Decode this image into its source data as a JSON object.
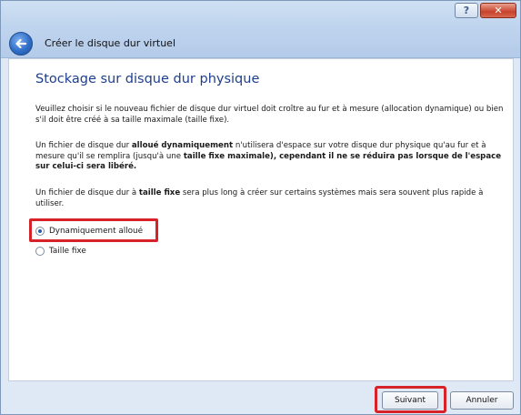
{
  "window": {
    "title": "Créer le disque dur virtuel",
    "help_label": "?",
    "close_label": "✕"
  },
  "page": {
    "heading": "Stockage sur disque dur physique"
  },
  "paragraphs": {
    "p1": "Veuillez choisir si le nouveau fichier de disque dur virtuel doit croître au fur et à mesure (allocation dynamique) ou bien s'il doit être créé à sa taille maximale (taille fixe).",
    "p2_a": "Un fichier de disque dur ",
    "p2_b": "alloué dynamiquement",
    "p2_c": " n'utilisera d'espace sur votre disque dur physique qu'au fur et à mesure qu'il se remplira (jusqu'à une ",
    "p2_d": "taille fixe maximale), cependant il ne se réduira pas lorsque de l'espace sur celui-ci sera libéré.",
    "p3_a": "Un fichier de disque dur à ",
    "p3_b": "taille fixe",
    "p3_c": " sera plus long à créer sur certains systèmes mais sera souvent plus rapide à utiliser."
  },
  "options": {
    "dynamic": "Dynamiquement alloué",
    "fixed": "Taille fixe",
    "selected": "dynamic"
  },
  "buttons": {
    "next": "Suivant",
    "cancel": "Annuler"
  },
  "colors": {
    "highlight": "#d8222a",
    "heading": "#1e3f8a",
    "titlebar": "#bfd4ee"
  }
}
